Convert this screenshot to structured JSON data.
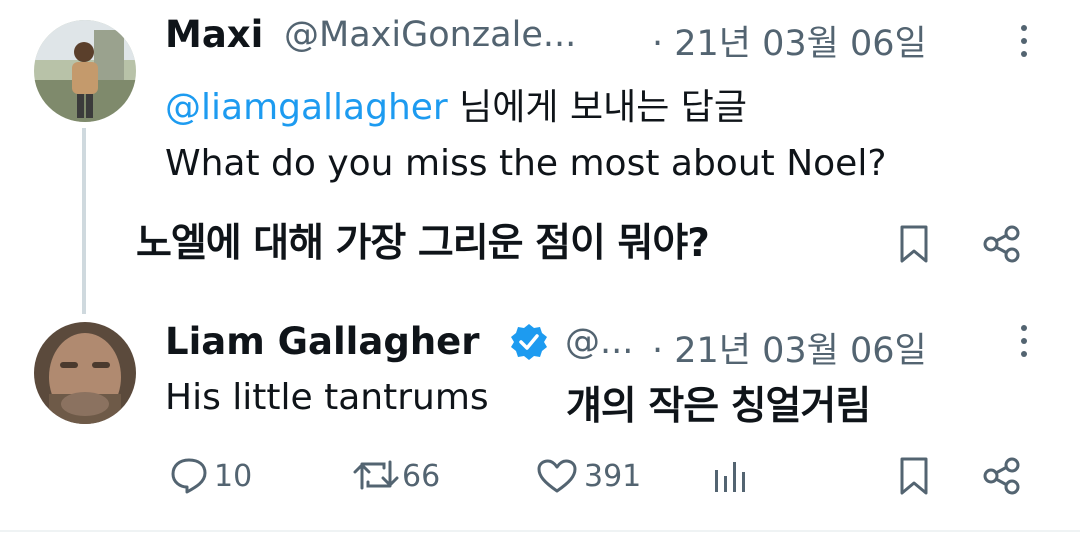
{
  "colors": {
    "accent": "#1d9bf0",
    "text": "#0f1419",
    "muted": "#536471"
  },
  "tweet1": {
    "author_name": "Maxi",
    "author_handle": "@MaxiGonzale...",
    "date": "· 21년 03월 06일",
    "reply_to_handle": "@liamgallagher",
    "reply_to_suffix": " 님에게 보내는 답글",
    "text": "What do you miss the most about Noel?",
    "translation": "노엘에 대해 가장 그리운 점이 뭐야?",
    "avatar_icon": "person-photo",
    "more_icon": "more-vertical-icon"
  },
  "tweet2": {
    "author_name": "Liam Gallagher",
    "verified_icon": "verified-badge-icon",
    "author_handle": "@...",
    "date": "· 21년 03월 06일",
    "text": "His little tantrums",
    "translation": "걔의 작은 칭얼거림",
    "avatar_icon": "person-photo",
    "more_icon": "more-vertical-icon",
    "actions": {
      "reply_count": "10",
      "retweet_count": "66",
      "like_count": "391"
    }
  }
}
